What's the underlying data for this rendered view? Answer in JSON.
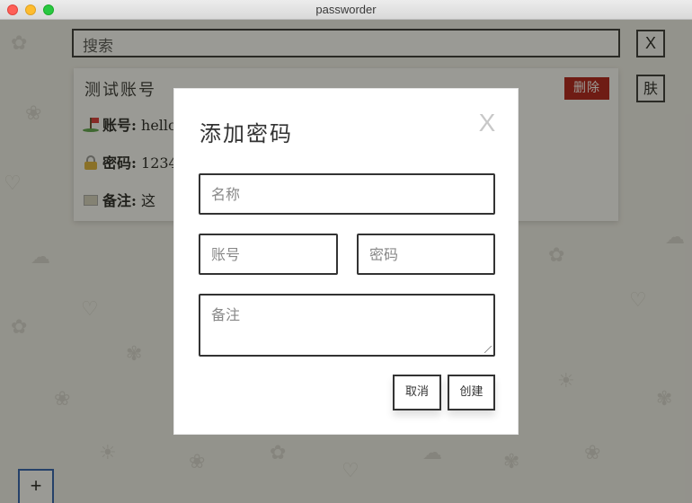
{
  "window": {
    "title": "passworder"
  },
  "search": {
    "placeholder": "搜索",
    "clear_label": "X"
  },
  "skin_button": {
    "label": "肤"
  },
  "card": {
    "title": "测试账号",
    "delete_label": "删除",
    "fields": [
      {
        "icon": "golf-flag-icon",
        "label": "账号:",
        "value": "hello"
      },
      {
        "icon": "lock-icon",
        "label": "密码:",
        "value": "1234"
      },
      {
        "icon": "scroll-icon",
        "label": "备注:",
        "value": "这"
      }
    ]
  },
  "modal": {
    "title": "添加密码",
    "close_label": "X",
    "name_placeholder": "名称",
    "account_placeholder": "账号",
    "password_placeholder": "密码",
    "note_placeholder": "备注",
    "cancel_label": "取消",
    "create_label": "创建"
  },
  "add_button": {
    "label": "+"
  },
  "colors": {
    "delete": "#b11a15",
    "add_border": "#2a5db0"
  }
}
